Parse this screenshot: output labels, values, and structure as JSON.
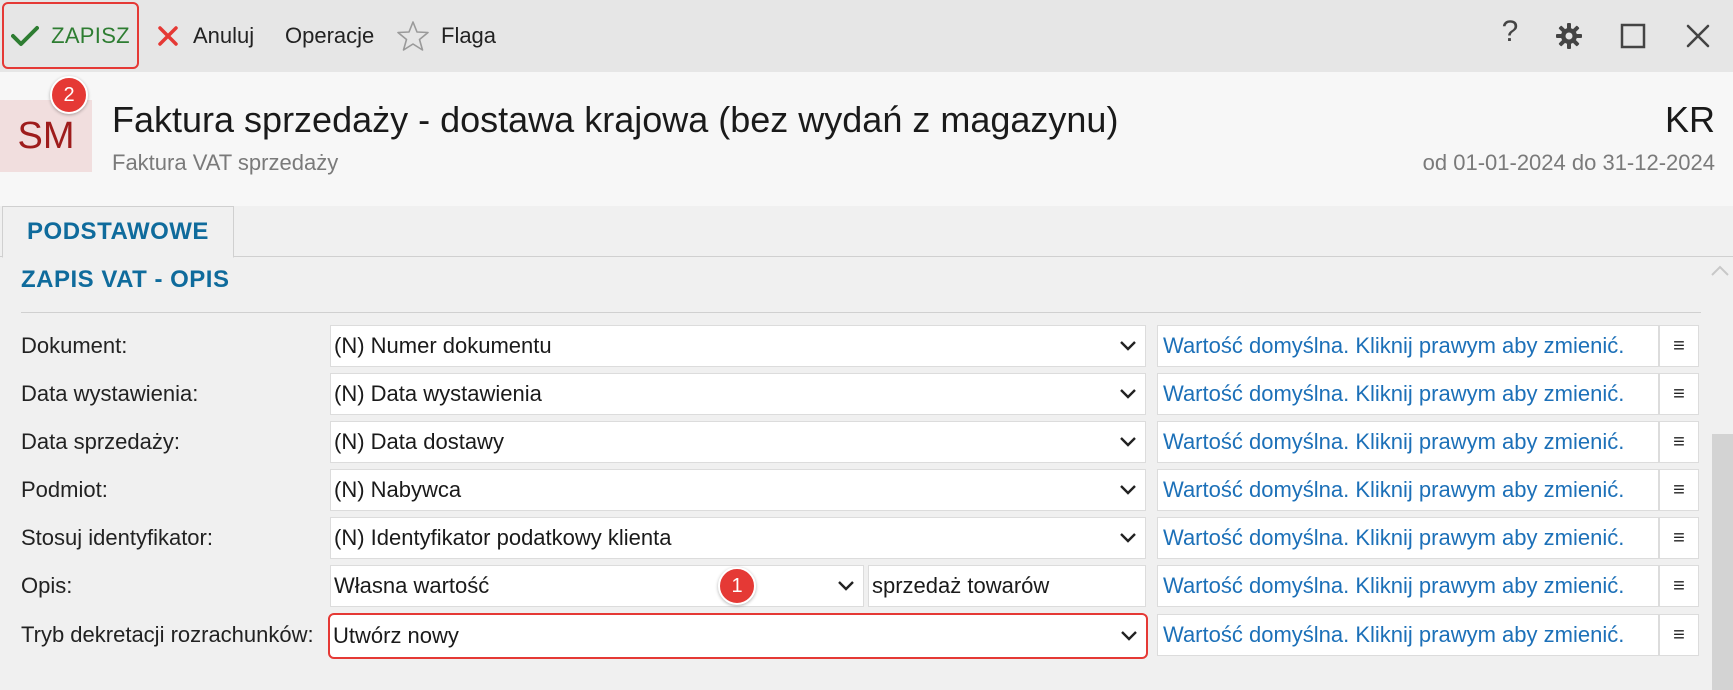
{
  "toolbar": {
    "save_label": "ZAPISZ",
    "cancel_label": "Anuluj",
    "operations_label": "Operacje",
    "flag_label": "Flaga",
    "help_glyph": "?"
  },
  "header": {
    "avatar_text": "SM",
    "title": "Faktura sprzedaży - dostawa krajowa (bez wydań z magazynu)",
    "subtitle": "Faktura VAT sprzedaży",
    "code": "KR",
    "date_range": "od 01-01-2024 do 31-12-2024"
  },
  "tabs": [
    {
      "label": "PODSTAWOWE",
      "active": true
    }
  ],
  "section": {
    "title": "ZAPIS VAT - OPIS"
  },
  "rows": [
    {
      "label": "Dokument:",
      "value": "(N) Numer dokumentu",
      "default_text": "Wartość domyślna. Kliknij prawym aby zmienić."
    },
    {
      "label": "Data wystawienia:",
      "value": "(N) Data wystawienia",
      "default_text": "Wartość domyślna. Kliknij prawym aby zmienić."
    },
    {
      "label": "Data sprzedaży:",
      "value": "(N) Data dostawy",
      "default_text": "Wartość domyślna. Kliknij prawym aby zmienić."
    },
    {
      "label": "Podmiot:",
      "value": "(N) Nabywca",
      "default_text": "Wartość domyślna. Kliknij prawym aby zmienić."
    },
    {
      "label": "Stosuj identyfikator:",
      "value": "(N) Identyfikator podatkowy klienta",
      "default_text": "Wartość domyślna. Kliknij prawym aby zmienić."
    },
    {
      "label": "Opis:",
      "value": "Własna wartość",
      "text_value": "sprzedaż towarów",
      "default_text": "Wartość domyślna. Kliknij prawym aby zmienić."
    },
    {
      "label": "Tryb dekretacji rozrachunków:",
      "value": "Utwórz nowy",
      "default_text": "Wartość domyślna. Kliknij prawym aby zmienić."
    }
  ],
  "annotations": {
    "badge_1": "1",
    "badge_2": "2"
  },
  "colors": {
    "accent": "#0f6b9c",
    "link": "#1c70b8",
    "save_green": "#2e7d32",
    "highlight_red": "#e53935",
    "avatar_text": "#9e1c1c"
  },
  "menu_glyph": "≡"
}
